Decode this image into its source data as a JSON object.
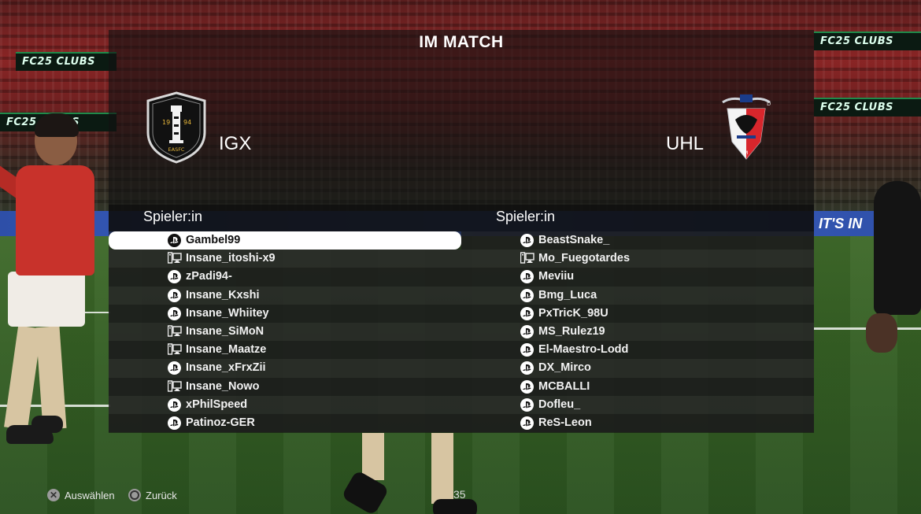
{
  "title": "IM MATCH",
  "home": {
    "name": "IGX",
    "crest_text": "EASFC",
    "crest_years": [
      "19",
      "94"
    ],
    "header": "Spieler:in",
    "players": [
      {
        "name": "Gambel99",
        "platform": "playstation-icon",
        "selected": true
      },
      {
        "name": "Insane_itoshi-x9",
        "platform": "pc-icon"
      },
      {
        "name": "zPadi94-",
        "platform": "playstation-icon"
      },
      {
        "name": "Insane_Kxshi",
        "platform": "playstation-icon"
      },
      {
        "name": "Insane_Whiitey",
        "platform": "playstation-icon"
      },
      {
        "name": "Insane_SiMoN",
        "platform": "pc-icon"
      },
      {
        "name": "Insane_Maatze",
        "platform": "pc-icon"
      },
      {
        "name": "Insane_xFrxZii",
        "platform": "playstation-icon"
      },
      {
        "name": "Insane_Nowo",
        "platform": "pc-icon"
      },
      {
        "name": "xPhilSpeed",
        "platform": "playstation-icon"
      },
      {
        "name": "Patinoz-GER",
        "platform": "playstation-icon"
      }
    ]
  },
  "away": {
    "name": "UHL",
    "header": "Spieler:in",
    "players": [
      {
        "name": "BeastSnake_",
        "platform": "playstation-icon"
      },
      {
        "name": "Mo_Fuegotardes",
        "platform": "pc-icon"
      },
      {
        "name": "Meviiu",
        "platform": "playstation-icon"
      },
      {
        "name": "Bmg_Luca",
        "platform": "playstation-icon"
      },
      {
        "name": "PxTricK_98U",
        "platform": "playstation-icon"
      },
      {
        "name": "MS_Rulez19",
        "platform": "playstation-icon"
      },
      {
        "name": "El-Maestro-Lodd",
        "platform": "playstation-icon"
      },
      {
        "name": "DX_Mirco",
        "platform": "playstation-icon"
      },
      {
        "name": "MCBALLI",
        "platform": "playstation-icon"
      },
      {
        "name": "Dofleu_",
        "platform": "playstation-icon"
      },
      {
        "name": "ReS-Leon",
        "platform": "playstation-icon"
      }
    ]
  },
  "footer": {
    "select_label": "Auswählen",
    "back_label": "Zurück",
    "timer": "35"
  },
  "scene": {
    "banner_text": "FC25 CLUBS",
    "board_text": "IT'S IN"
  },
  "colors": {
    "selected_row": "#ffffff",
    "panel_bg": "#121212",
    "banner_accent": "#1f8a4a"
  }
}
